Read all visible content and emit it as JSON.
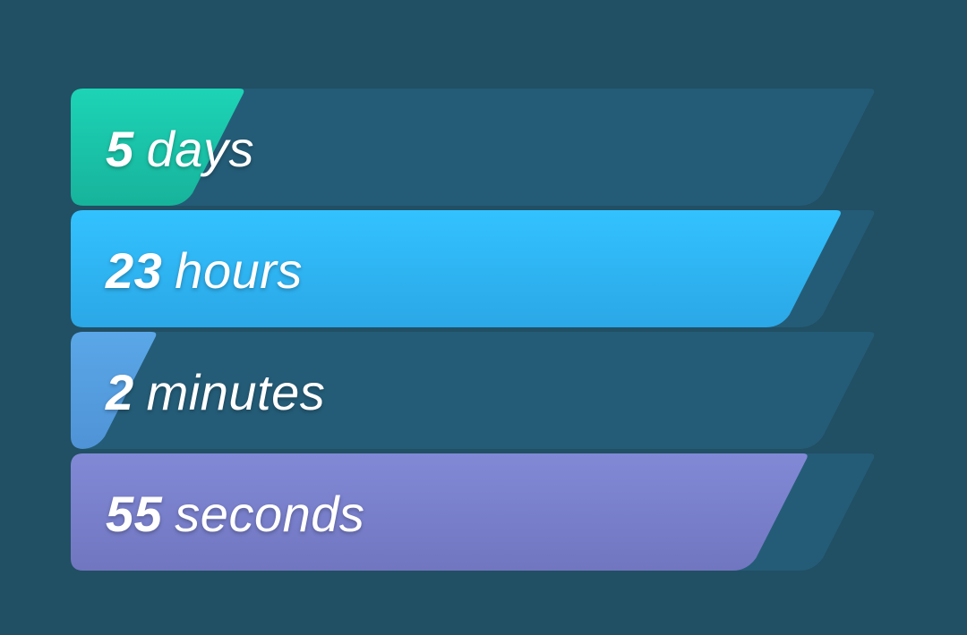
{
  "countdown": {
    "units": [
      {
        "value": "5",
        "unit": "days",
        "fraction": 0.2143,
        "color_top": "#1dd4b6",
        "color_bottom": "#17b39b"
      },
      {
        "value": "23",
        "unit": "hours",
        "fraction": 0.9583,
        "color_top": "#33c2ff",
        "color_bottom": "#2ba7e6"
      },
      {
        "value": "2",
        "unit": "minutes",
        "fraction": 0.0333,
        "color_top": "#5aa7e8",
        "color_bottom": "#4f93d6"
      },
      {
        "value": "55",
        "unit": "seconds",
        "fraction": 0.9167,
        "color_top": "#8189d6",
        "color_bottom": "#7176c0"
      }
    ],
    "track_color": "#245c77",
    "background_color": "#214f63"
  }
}
